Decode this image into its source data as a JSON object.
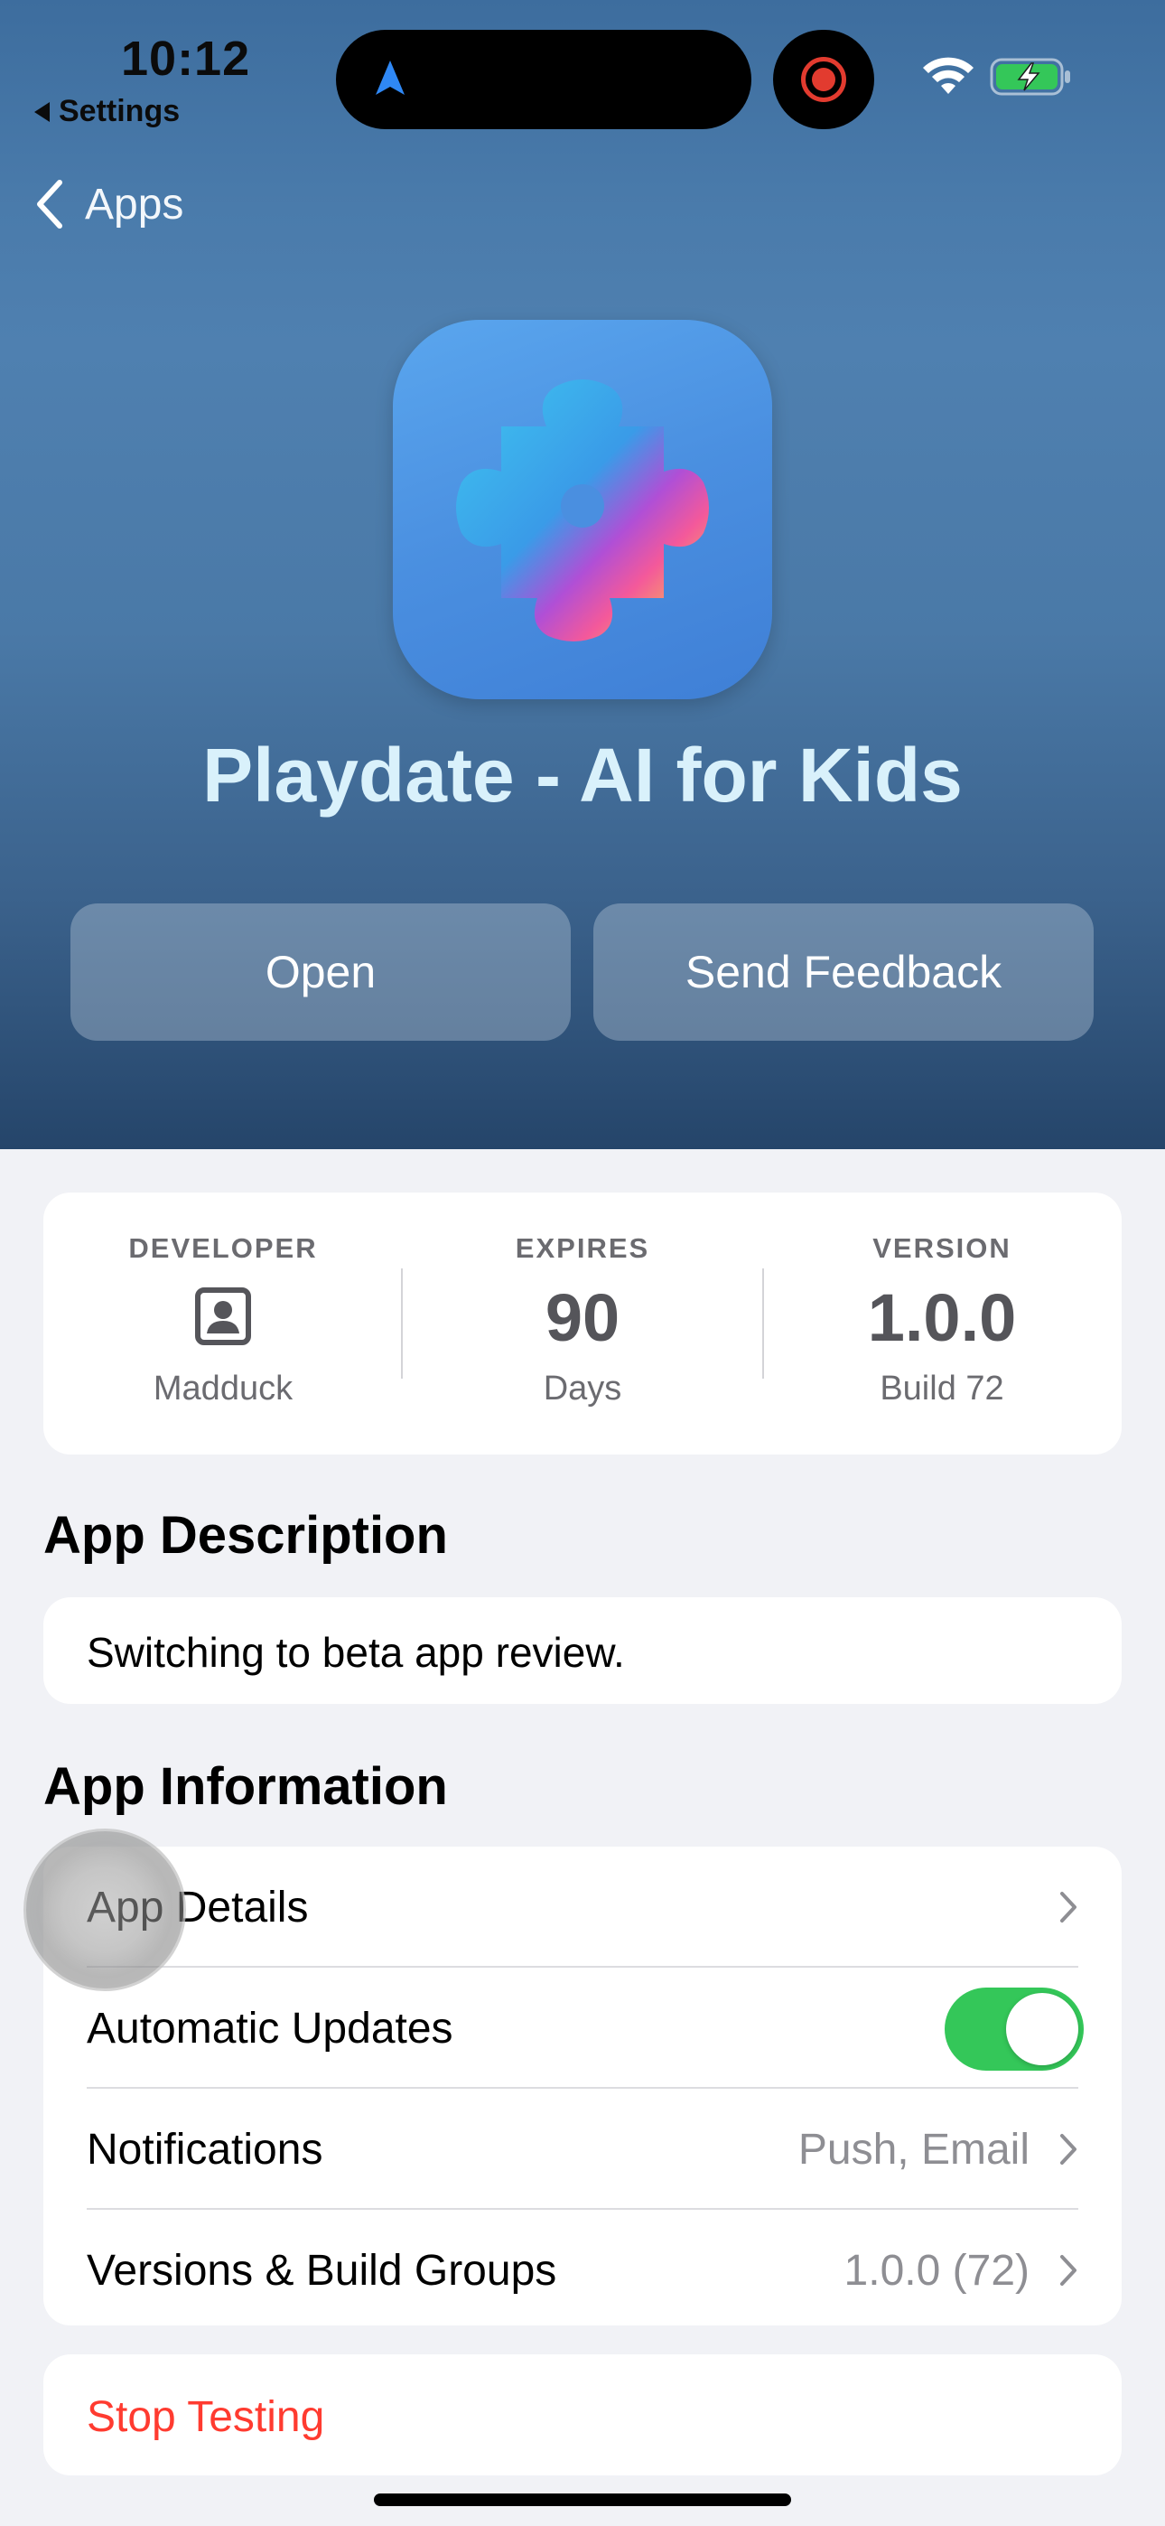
{
  "status_bar": {
    "time": "10:12",
    "back_app_label": "Settings"
  },
  "nav": {
    "back_label": "Apps"
  },
  "app": {
    "title": "Playdate - AI for Kids",
    "icon": "puzzle-piece-icon"
  },
  "actions": {
    "open_label": "Open",
    "feedback_label": "Send Feedback"
  },
  "stats": {
    "developer": {
      "label": "DEVELOPER",
      "value": "Madduck",
      "icon": "person-square-icon"
    },
    "expires": {
      "label": "EXPIRES",
      "value": "90",
      "sub": "Days"
    },
    "version": {
      "label": "VERSION",
      "value": "1.0.0",
      "sub": "Build 72"
    }
  },
  "description": {
    "heading": "App Description",
    "text": "Switching to beta app review."
  },
  "information": {
    "heading": "App Information",
    "rows": [
      {
        "label": "App Details",
        "value": ""
      },
      {
        "label": "Automatic Updates",
        "toggle_on": true
      },
      {
        "label": "Notifications",
        "value": "Push, Email"
      },
      {
        "label": "Versions & Build Groups",
        "value": "1.0.0 (72)"
      }
    ]
  },
  "stop": {
    "label": "Stop Testing"
  },
  "colors": {
    "accent_green": "#34c759",
    "destructive_red": "#ff3b30",
    "title_color": "#d9f1fb"
  }
}
